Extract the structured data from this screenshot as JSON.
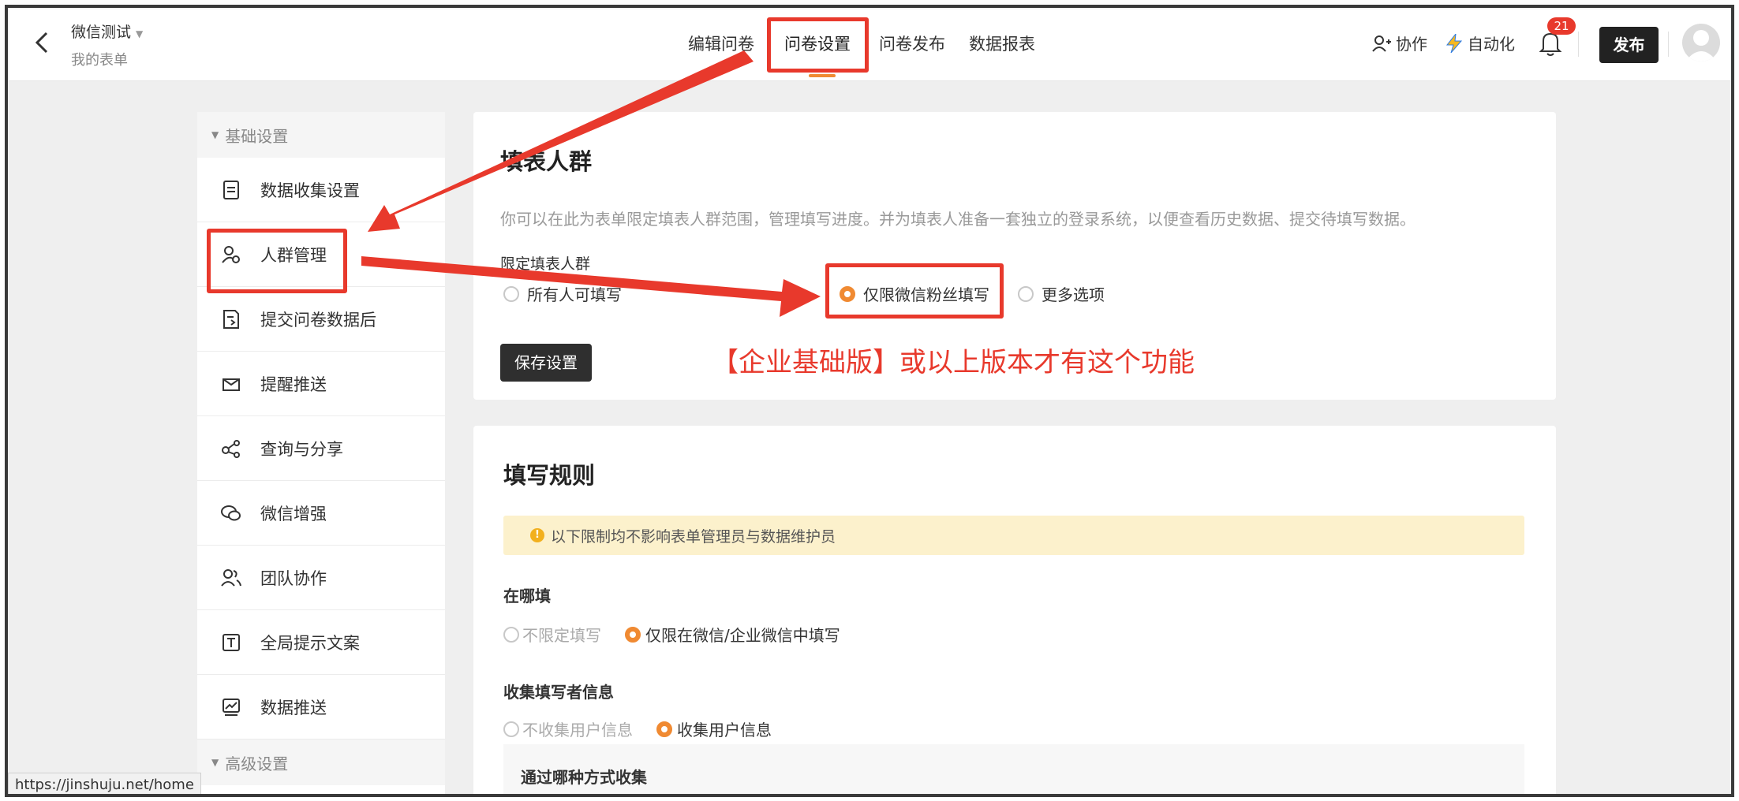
{
  "header": {
    "title": "微信测试",
    "subtitle": "我的表单",
    "tabs": [
      {
        "label": "编辑问卷"
      },
      {
        "label": "问卷设置"
      },
      {
        "label": "问卷发布"
      },
      {
        "label": "数据报表"
      }
    ],
    "active_tab": "问卷设置",
    "collab_label": "协作",
    "automation_label": "自动化",
    "notification_count": "21",
    "publish_label": "发布"
  },
  "sidebar": {
    "group_basic": "基础设置",
    "items": [
      {
        "label": "数据收集设置",
        "icon": "document-icon"
      },
      {
        "label": "人群管理",
        "icon": "user-group-icon"
      },
      {
        "label": "提交问卷数据后",
        "icon": "document-arrow-icon"
      },
      {
        "label": "提醒推送",
        "icon": "reminder-icon"
      },
      {
        "label": "查询与分享",
        "icon": "share-icon"
      },
      {
        "label": "微信增强",
        "icon": "wechat-icon"
      },
      {
        "label": "团队协作",
        "icon": "team-icon"
      },
      {
        "label": "全局提示文案",
        "icon": "text-icon"
      },
      {
        "label": "数据推送",
        "icon": "chart-push-icon"
      }
    ],
    "group_advanced": "高级设置"
  },
  "audience_card": {
    "title": "填表人群",
    "description": "你可以在此为表单限定填表人群范围，管理填写进度。并为填表人准备一套独立的登录系统，以便查看历史数据、提交待填写数据。",
    "limit_label": "限定填表人群",
    "options": [
      {
        "label": "所有人可填写",
        "selected": false
      },
      {
        "label": "仅限微信粉丝填写",
        "selected": true
      },
      {
        "label": "更多选项",
        "selected": false
      }
    ],
    "save_label": "保存设置",
    "annotation": "【企业基础版】或以上版本才有这个功能"
  },
  "rules_card": {
    "title": "填写规则",
    "notice": "以下限制均不影响表单管理员与数据维护员",
    "where_label": "在哪填",
    "where_options": [
      {
        "label": "不限定填写",
        "selected": false
      },
      {
        "label": "仅限在微信/企业微信中填写",
        "selected": true
      }
    ],
    "collect_label": "收集填写者信息",
    "collect_options": [
      {
        "label": "不收集用户信息",
        "selected": false
      },
      {
        "label": "收集用户信息",
        "selected": true
      }
    ],
    "method_label": "通过哪种方式收集"
  },
  "status_url": "https://jinshuju.net/home",
  "colors": {
    "accent": "#f08a32",
    "annotation_red": "#e8392c",
    "dark_button": "#2f2f2f",
    "notice_bg": "#fcf1cc"
  }
}
